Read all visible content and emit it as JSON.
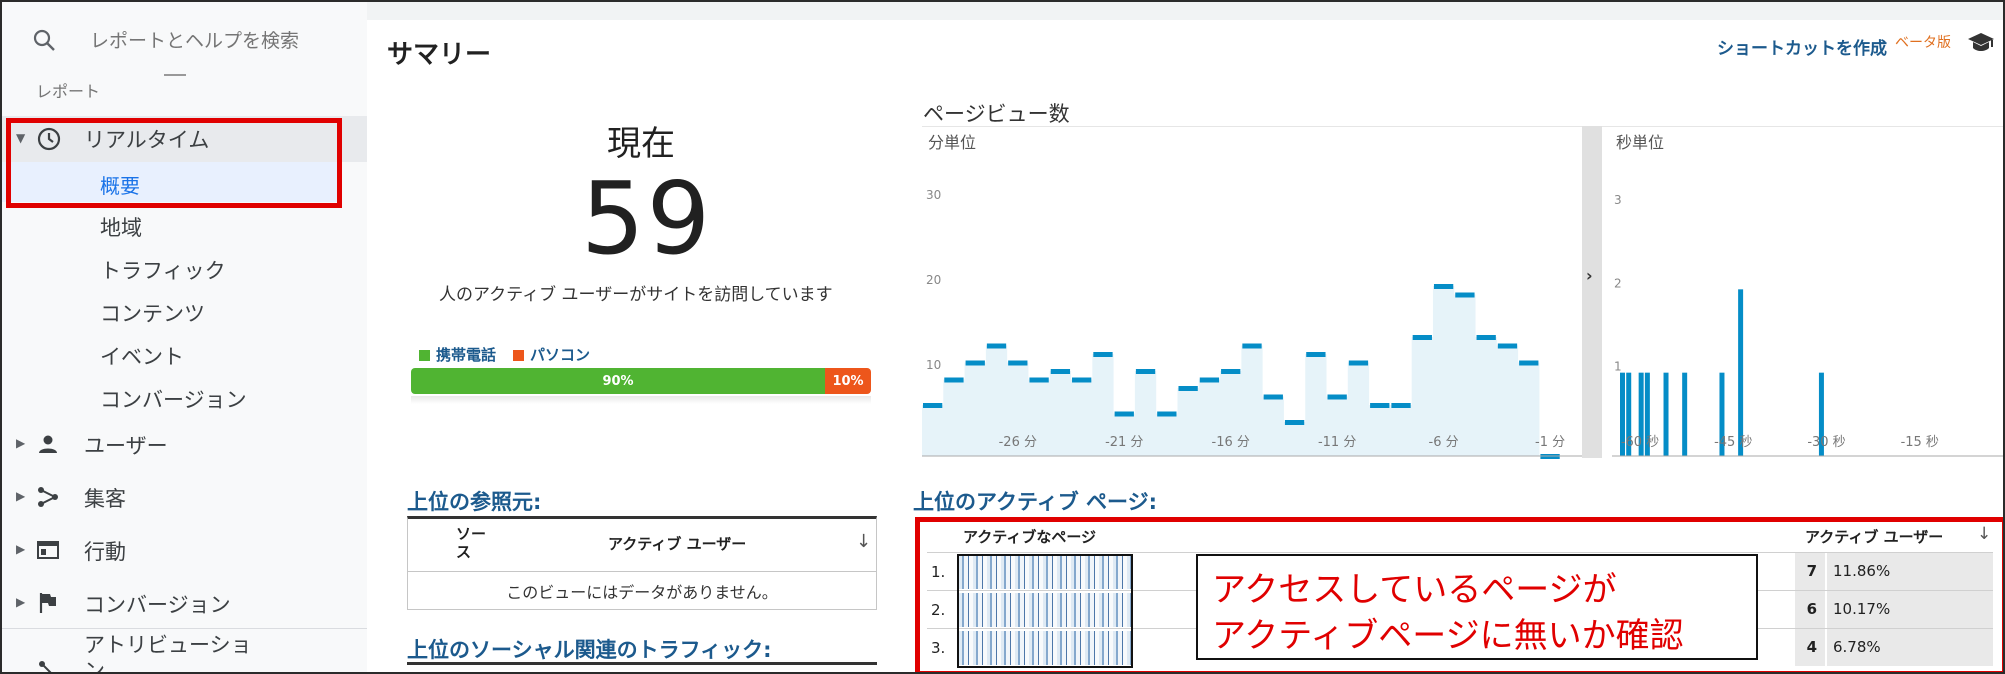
{
  "sidebar": {
    "search_placeholder": "レポートとヘルプを検索",
    "reports_label": "レポート",
    "realtime": {
      "label": "リアルタイム",
      "sub_items": [
        "概要",
        "地域",
        "トラフィック",
        "コンテンツ",
        "イベント",
        "コンバージョン"
      ]
    },
    "sections": [
      {
        "label": "ユーザー",
        "icon": "person-icon"
      },
      {
        "label": "集客",
        "icon": "acquisition-icon"
      },
      {
        "label": "行動",
        "icon": "behavior-icon"
      },
      {
        "label": "コンバージョン",
        "icon": "flag-icon"
      },
      {
        "label": "アトリビューショ",
        "icon": "attribution-icon"
      }
    ],
    "attribution_wrap": "ン"
  },
  "header": {
    "title": "サマリー",
    "shortcut_label": "ショートカットを作成",
    "beta_label": "ベータ版",
    "accent_color": "#1c5a8d",
    "beta_color": "#e07020"
  },
  "now": {
    "label": "現在",
    "count": "59",
    "description": "人のアクティブ ユーザーがサイトを訪問しています",
    "legend_mobile": "携帯電話",
    "legend_desktop": "パソコン",
    "mobile_pct": "90%",
    "desktop_pct": "10%",
    "mobile_share": 0.9,
    "desktop_share": 0.1,
    "mobile_color": "#50b432",
    "desktop_color": "#ed561b"
  },
  "referrers": {
    "title": "上位の参照元:",
    "col_source": "ソース",
    "col_users": "アクティブ ユーザー",
    "empty": "このビューにはデータがありません。"
  },
  "social": {
    "title": "上位のソーシャル関連のトラフィック:"
  },
  "pageviews": {
    "title": "ページビュー数",
    "minute_label": "分単位",
    "second_label": "秒単位"
  },
  "chart_data": [
    {
      "type": "bar",
      "title": "分単位",
      "xlabel": "",
      "ylabel": "",
      "ylim": [
        0,
        30
      ],
      "yticks": [
        "10",
        "20",
        "30"
      ],
      "xtick_labels": [
        "-26 分",
        "-21 分",
        "-16 分",
        "-11 分",
        "-6 分",
        "-1 分"
      ],
      "x": [
        -30,
        -29,
        -28,
        -27,
        -26,
        -25,
        -24,
        -23,
        -22,
        -21,
        -20,
        -19,
        -18,
        -17,
        -16,
        -15,
        -14,
        -13,
        -12,
        -11,
        -10,
        -9,
        -8,
        -7,
        -6,
        -5,
        -4,
        -3,
        -2,
        -1,
        0
      ],
      "values": [
        6,
        9,
        11,
        13,
        11,
        9,
        10,
        9,
        12,
        5,
        10,
        5,
        8,
        9,
        10,
        13,
        7,
        4,
        12,
        7,
        11,
        6,
        6,
        14,
        20,
        19,
        14,
        13,
        11,
        0
      ],
      "color": "#058dc7"
    },
    {
      "type": "bar",
      "title": "秒単位",
      "xlabel": "",
      "ylabel": "",
      "ylim": [
        0,
        3
      ],
      "yticks": [
        "1",
        "2",
        "3"
      ],
      "xtick_labels": [
        "-60 秒",
        "-45 秒",
        "-30 秒",
        "-15 秒"
      ],
      "x": [
        -60,
        -59,
        -57,
        -56,
        -53,
        -50,
        -44,
        -41,
        -28
      ],
      "values": [
        1,
        1,
        1,
        1,
        1,
        1,
        1,
        2,
        1
      ],
      "color": "#058dc7"
    }
  ],
  "active_pages": {
    "title": "上位のアクティブ ページ:",
    "col_page": "アクティブなページ",
    "col_users": "アクティブ ユーザー",
    "rows": [
      {
        "index": "1.",
        "users": "7",
        "pct": "11.86%"
      },
      {
        "index": "2.",
        "users": "6",
        "pct": "10.17%"
      },
      {
        "index": "3.",
        "users": "4",
        "pct": "6.78%"
      }
    ],
    "callout_lines": [
      "アクセスしているページが",
      "アクティブページに無いか確認"
    ]
  }
}
